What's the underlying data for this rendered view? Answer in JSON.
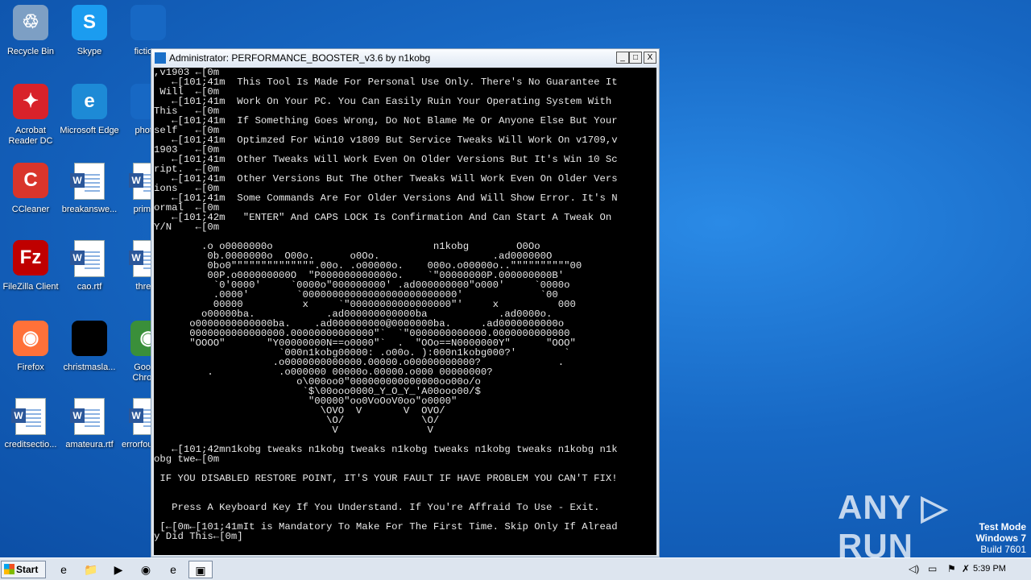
{
  "desktop": {
    "icons": [
      {
        "label": "Recycle Bin",
        "glyph": "♲",
        "color": "#7d9fc4"
      },
      {
        "label": "Skype",
        "glyph": "S",
        "color": "#1b9cf0"
      },
      {
        "label": "fictiona",
        "glyph": "",
        "color": "#1768c4"
      },
      {
        "label": "Acrobat Reader DC",
        "glyph": "✦",
        "color": "#d8222a"
      },
      {
        "label": "Microsoft Edge",
        "glyph": "e",
        "color": "#1d8ad6"
      },
      {
        "label": "photos",
        "glyph": "",
        "color": "#1768c4"
      },
      {
        "label": "CCleaner",
        "glyph": "C",
        "color": "#d9352b"
      },
      {
        "label": "breakanswe...",
        "glyph": "W",
        "color": "#2b579a"
      },
      {
        "label": "primary",
        "glyph": "W",
        "color": "#2b579a"
      },
      {
        "label": "FileZilla Client",
        "glyph": "Fz",
        "color": "#bf0000"
      },
      {
        "label": "cao.rtf",
        "glyph": "W",
        "color": "#2b579a"
      },
      {
        "label": "thread",
        "glyph": "W",
        "color": "#2b579a"
      },
      {
        "label": "Firefox",
        "glyph": "◉",
        "color": "#ff7139"
      },
      {
        "label": "christmasla...",
        "glyph": "",
        "color": "#000000"
      },
      {
        "label": "Google Chrome",
        "glyph": "◉",
        "color": "#3a8f3a"
      },
      {
        "label": "creditsectio...",
        "glyph": "W",
        "color": "#2b579a"
      },
      {
        "label": "amateura.rtf",
        "glyph": "W",
        "color": "#2b579a"
      },
      {
        "label": "errorfounda...",
        "glyph": "W",
        "color": "#2b579a"
      }
    ]
  },
  "window": {
    "title": "Administrator:  PERFORMANCE_BOOSTER_v3.6 by n1kobg",
    "minimize": "_",
    "maximize": "□",
    "close": "X",
    "console_lines": [
      ",v1903 ←[0m",
      "   ←[101;41m  This Tool Is Made For Personal Use Only. There's No Guarantee It",
      " Will  ←[0m",
      "   ←[101;41m  Work On Your PC. You Can Easily Ruin Your Operating System With",
      "This   ←[0m",
      "   ←[101;41m  If Something Goes Wrong, Do Not Blame Me Or Anyone Else But Your",
      "self   ←[0m",
      "   ←[101;41m  Optimzed For Win10 v1809 But Service Tweaks Will Work On v1709,v",
      "1903   ←[0m",
      "   ←[101;41m  Other Tweaks Will Work Even On Older Versions But It's Win 10 Sc",
      "ript.  ←[0m",
      "   ←[101;41m  Other Versions But The Other Tweaks Will Work Even On Older Vers",
      "ions   ←[0m",
      "   ←[101;41m  Some Commands Are For Older Versions And Will Show Error. It's N",
      "ormal  ←[0m",
      "   ←[101;42m   \"ENTER\" And CAPS LOCK Is Confirmation And Can Start A Tweak On",
      "Y/N    ←[0m"
    ],
    "art_lines": [
      "",
      "        .o o0000000o                           n1kobg        O0Oo",
      "         0b.0000000o  O00o.      o0Oo.                   .ad000000O",
      "         0bo0\"\"\"\"\"\"\"\"\"\"\"\"\"\".00o. .o00000o.    000o.o00000o..\"\"\"\"\"\"\"\"\"\"00",
      "         00P.o000000000O  \"P000000000000o.    `\"00000000P.000000000B'",
      "          `0'0000'     `0000o\"000000000' .ad000000000\"o000'     `0000o",
      "          .0000'        `00000000000000000000000000'             `00",
      "          00000          x     `\"00000000000000000\"'     x          000",
      "        o00000ba.            .ad000000000000ba            .ad0000o.",
      "      o0000000000000ba.    .ad000000000@0000000ba.     .ad0000000000o",
      "      0000000000000000.00000000000000\"`  `\"0000000000000.0000000000000",
      "      \"OOOO\"       \"Y00000000N==o0000\"`  .  \"OOo==N0000000Y\"      \"OOO\"",
      "                     `000n1kobg00000: .o00o. ):000n1kobg000?'        `",
      "                    .o0000000000000.00000.o00000000000?             .",
      "         .           .o000000 00000o.00000.o000 00000000?",
      "                        o\\000oo0\"000000000000000oo00o/o",
      "                         `$\\00ooo0000_Y_O_Y_'A00ooo00/$",
      "                          \"00000\"oo0VoOoV0oo\"o0000\"",
      "                            \\OVO  V       V  OVO/",
      "                             \\O/             \\O/",
      "                              V               V"
    ],
    "tail_lines": [
      "",
      "   ←[101;42mn1kobg tweaks n1kobg tweaks n1kobg tweaks n1kobg tweaks n1kobg n1k",
      "obg twe←[0m",
      "",
      " IF YOU DISABLED RESTORE POINT, IT'S YOUR FAULT IF HAVE PROBLEM YOU CAN'T FIX!",
      "",
      "",
      "   Press A Keyboard Key If You Understand. If You're Affraid To Use - Exit.",
      "",
      " [←[0m←[101;41mIt is Mandatory To Make For The First Time. Skip Only If Alread",
      "y Did This←[0m]"
    ]
  },
  "watermark": "ANY ▷ RUN",
  "testmode": {
    "line1": "Test Mode",
    "line2": "Windows 7",
    "line3": "Build 7601"
  },
  "taskbar": {
    "start_label": "Start",
    "items": [
      "e",
      "📁",
      "▶",
      "◉",
      "e",
      "▣"
    ],
    "tray_icons": [
      "◁)",
      "▭",
      "⚑",
      "✗"
    ],
    "clock": "5:39 PM"
  }
}
